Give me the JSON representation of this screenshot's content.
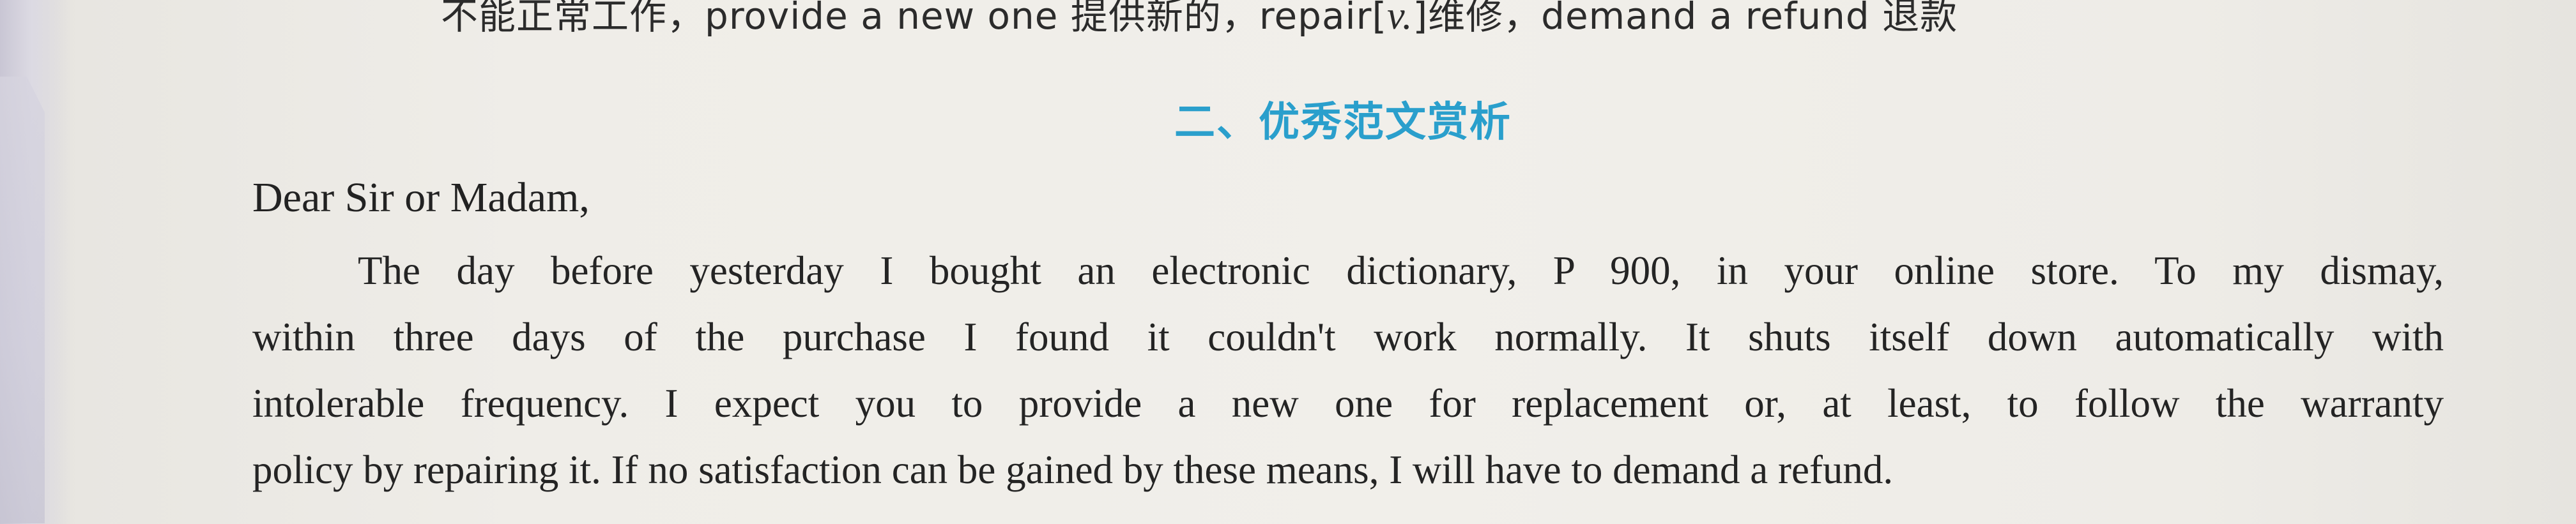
{
  "document": {
    "top_line": {
      "part1": "不能正常工作，provide a new one 提供新的，repair[",
      "part2": "v.",
      "part3": "]维修，demand a refund 退款"
    },
    "section_heading": "二、优秀范文赏析",
    "salutation": "Dear Sir or Madam,",
    "body_lines": [
      "The day before yesterday I bought an electronic dictionary, P 900, in your online store. To my dismay,",
      "within three days of the purchase I found it couldn't work normally. It shuts itself down automatically with",
      "intolerable frequency. I expect you to provide a new one for replacement or, at least, to follow the warranty",
      "policy by repairing it. If no satisfaction can be gained by these means, I will have to demand a refund."
    ]
  }
}
